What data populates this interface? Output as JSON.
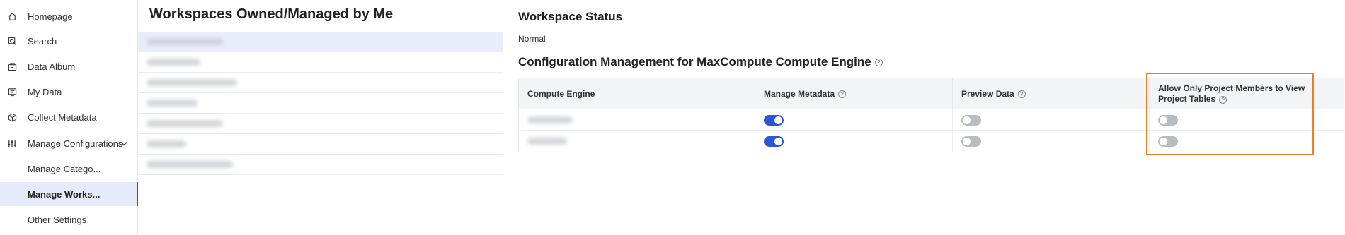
{
  "sidebar": {
    "items": [
      {
        "label": "Homepage",
        "icon": "home-icon"
      },
      {
        "label": "Search",
        "icon": "search-icon"
      },
      {
        "label": "Data Album",
        "icon": "album-icon"
      },
      {
        "label": "My Data",
        "icon": "my-data-icon"
      },
      {
        "label": "Collect Metadata",
        "icon": "cube-icon"
      },
      {
        "label": "Manage Configurations",
        "icon": "sliders-icon",
        "expanded": true
      },
      {
        "label": "Manage Catego..."
      },
      {
        "label": "Manage Works...",
        "active": true
      },
      {
        "label": "Other Settings"
      }
    ],
    "active_color": "#2b56d6"
  },
  "list_panel": {
    "title": "Workspaces Owned/Managed by Me"
  },
  "detail": {
    "status_heading": "Workspace Status",
    "status_value": "Normal",
    "config_heading": "Configuration Management for MaxCompute Compute Engine",
    "table": {
      "headers": [
        "Compute Engine",
        "Manage Metadata",
        "Preview Data",
        "Allow Only Project Members to View Project Tables"
      ],
      "rows": [
        {
          "manage_metadata": true,
          "preview_data": false,
          "members_only": false
        },
        {
          "manage_metadata": true,
          "preview_data": false,
          "members_only": false
        }
      ]
    },
    "highlight_color": "#f07c28"
  }
}
